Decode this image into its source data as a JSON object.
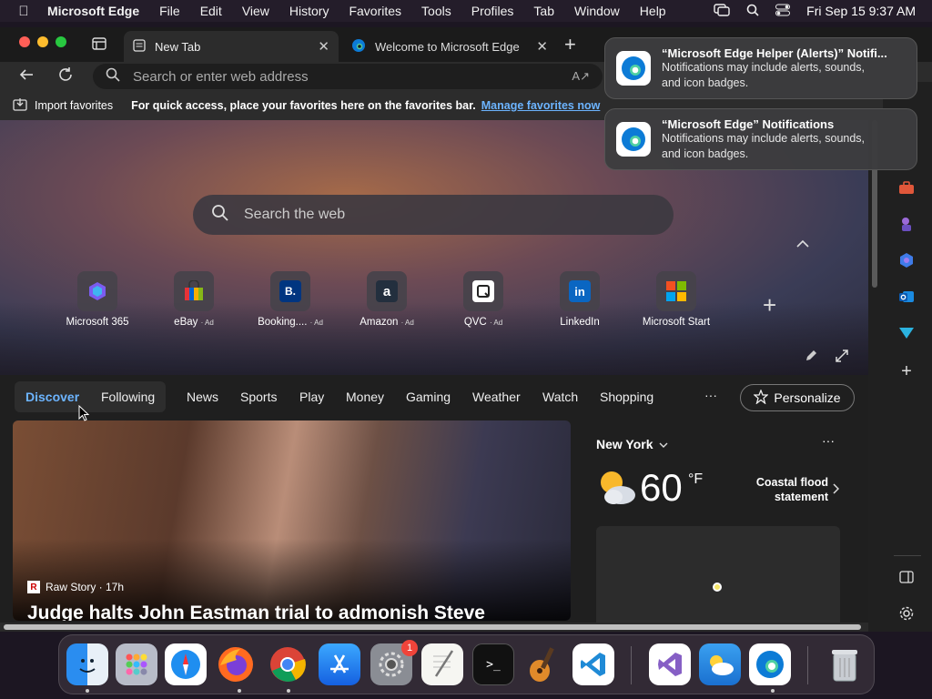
{
  "menubar": {
    "app": "Microsoft Edge",
    "items": [
      "File",
      "Edit",
      "View",
      "History",
      "Favorites",
      "Tools",
      "Profiles",
      "Tab",
      "Window",
      "Help"
    ],
    "datetime": "Fri Sep 15  9:37 AM"
  },
  "tabs": {
    "active": "New Tab",
    "inactive": "Welcome to Microsoft Edge"
  },
  "address": {
    "placeholder": "Search or enter web address"
  },
  "favbar": {
    "import": "Import favorites",
    "hint": "For quick access, place your favorites here on the favorites bar.",
    "manage": "Manage favorites now"
  },
  "search": {
    "placeholder": "Search the web"
  },
  "tiles": [
    {
      "label": "Microsoft 365",
      "ad": "",
      "icon": "microsoft-365-icon"
    },
    {
      "label": "eBay",
      "ad": "· Ad",
      "icon": "ebay-icon"
    },
    {
      "label": "Booking....",
      "ad": "· Ad",
      "icon": "booking-icon"
    },
    {
      "label": "Amazon",
      "ad": "· Ad",
      "icon": "amazon-icon"
    },
    {
      "label": "QVC",
      "ad": "· Ad",
      "icon": "qvc-icon"
    },
    {
      "label": "LinkedIn",
      "ad": "",
      "icon": "linkedin-icon"
    },
    {
      "label": "Microsoft Start",
      "ad": "",
      "icon": "microsoft-start-icon"
    }
  ],
  "feed": {
    "tabs": [
      "Discover",
      "Following",
      "News",
      "Sports",
      "Play",
      "Money",
      "Gaming",
      "Weather",
      "Watch",
      "Shopping"
    ],
    "more": "···",
    "personalize": "Personalize"
  },
  "article": {
    "source": "Raw Story · 17h",
    "headline": "Judge halts John Eastman trial to admonish Steve"
  },
  "weather": {
    "city": "New York",
    "temp": "60",
    "unit": "°F",
    "alert_line1": "Coastal flood",
    "alert_line2": "statement",
    "more": "···"
  },
  "notifications": [
    {
      "title": "“Microsoft Edge Helper (Alerts)” Notifi...",
      "line1": "Notifications may include alerts, sounds,",
      "line2": "and icon badges."
    },
    {
      "title": "“Microsoft Edge” Notifications",
      "line1": "Notifications may include alerts, sounds,",
      "line2": "and icon badges."
    }
  ],
  "dock_badge": "1",
  "colors": {
    "accent": "#4aa3ff",
    "edge_blue": "#0c7bd6"
  }
}
